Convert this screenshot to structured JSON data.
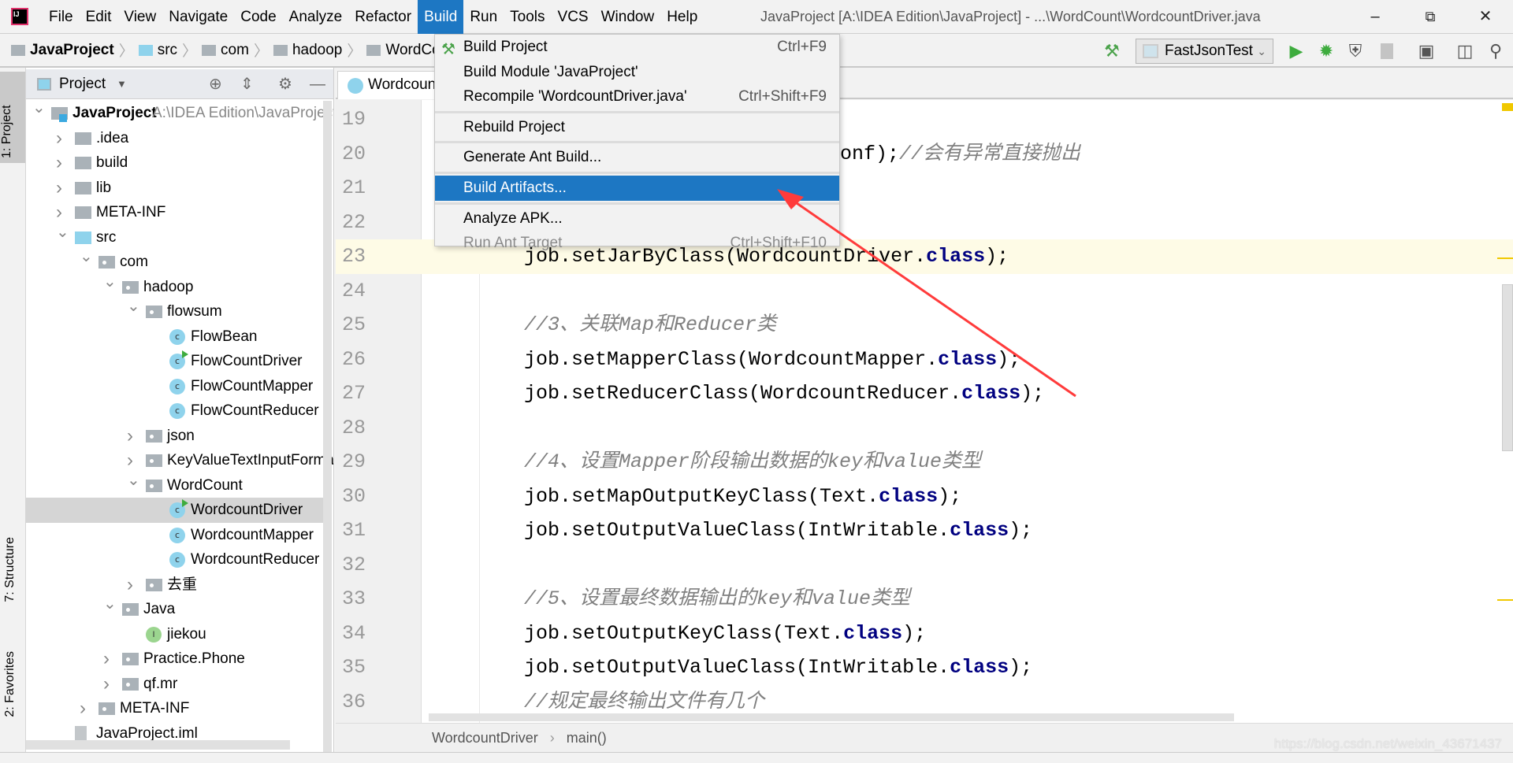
{
  "menubar": {
    "items": [
      "File",
      "Edit",
      "View",
      "Navigate",
      "Code",
      "Analyze",
      "Refactor",
      "Build",
      "Run",
      "Tools",
      "VCS",
      "Window",
      "Help"
    ],
    "active": "Build"
  },
  "window": {
    "title": "JavaProject [A:\\IDEA Edition\\JavaProject] - ...\\WordCount\\WordcountDriver.java"
  },
  "breadcrumb": [
    "JavaProject",
    "src",
    "com",
    "hadoop",
    "WordCount"
  ],
  "toolbar": {
    "run_config": "FastJsonTest"
  },
  "stripe": {
    "project": "1: Project",
    "structure": "7: Structure",
    "favorites": "2: Favorites"
  },
  "project_panel": {
    "title": "Project",
    "tree": [
      {
        "label": "JavaProject",
        "path": "A:\\IDEA Edition\\JavaProject",
        "level": 0,
        "state": "open",
        "icon": "module"
      },
      {
        "label": ".idea",
        "level": 1,
        "state": "closed",
        "icon": "folder"
      },
      {
        "label": "build",
        "level": 1,
        "state": "closed",
        "icon": "folder"
      },
      {
        "label": "lib",
        "level": 1,
        "state": "closed",
        "icon": "folder"
      },
      {
        "label": "META-INF",
        "level": 1,
        "state": "closed",
        "icon": "folder"
      },
      {
        "label": "src",
        "level": 1,
        "state": "open",
        "icon": "source-folder"
      },
      {
        "label": "com",
        "level": 2,
        "state": "open",
        "icon": "package"
      },
      {
        "label": "hadoop",
        "level": 3,
        "state": "open",
        "icon": "package"
      },
      {
        "label": "flowsum",
        "level": 4,
        "state": "open",
        "icon": "package"
      },
      {
        "label": "FlowBean",
        "level": 5,
        "icon": "class"
      },
      {
        "label": "FlowCountDriver",
        "level": 5,
        "icon": "class-runnable"
      },
      {
        "label": "FlowCountMapper",
        "level": 5,
        "icon": "class"
      },
      {
        "label": "FlowCountReducer",
        "level": 5,
        "icon": "class"
      },
      {
        "label": "json",
        "level": 4,
        "state": "closed",
        "icon": "package"
      },
      {
        "label": "KeyValueTextInputForma",
        "level": 4,
        "state": "closed",
        "icon": "package"
      },
      {
        "label": "WordCount",
        "level": 4,
        "state": "open",
        "icon": "package"
      },
      {
        "label": "WordcountDriver",
        "level": 5,
        "icon": "class-runnable",
        "selected": true
      },
      {
        "label": "WordcountMapper",
        "level": 5,
        "icon": "class"
      },
      {
        "label": "WordcountReducer",
        "level": 5,
        "icon": "class"
      },
      {
        "label": "去重",
        "level": 4,
        "state": "closed",
        "icon": "package"
      },
      {
        "label": "Java",
        "level": 3,
        "state": "open",
        "icon": "package"
      },
      {
        "label": "jiekou",
        "level": 4,
        "icon": "interface"
      },
      {
        "label": "Practice.Phone",
        "level": 3,
        "state": "closed",
        "icon": "package"
      },
      {
        "label": "qf.mr",
        "level": 3,
        "state": "closed",
        "icon": "package"
      },
      {
        "label": "META-INF",
        "level": 2,
        "state": "closed",
        "icon": "package"
      },
      {
        "label": "JavaProject.iml",
        "level": 1,
        "icon": "file"
      }
    ]
  },
  "editor": {
    "tab": "WordcountDriver.java",
    "caret_line": 23,
    "lines": [
      {
        "n": "19",
        "seg": []
      },
      {
        "n": "20",
        "seg": [
          {
            "t": "conf);"
          },
          {
            "t": "//会有异常直接抛出",
            "c": "cm"
          }
        ]
      },
      {
        "n": "21",
        "seg": []
      },
      {
        "n": "22",
        "seg": []
      },
      {
        "n": "23",
        "seg": [
          {
            "t": "job.setJarByClass(WordcountDriver."
          },
          {
            "t": "class",
            "c": "kw"
          },
          {
            "t": ");"
          }
        ]
      },
      {
        "n": "24",
        "seg": []
      },
      {
        "n": "25",
        "seg": [
          {
            "t": "//3、关联Map和Reducer类",
            "c": "cm"
          }
        ]
      },
      {
        "n": "26",
        "seg": [
          {
            "t": "job.setMapperClass(WordcountMapper."
          },
          {
            "t": "class",
            "c": "kw"
          },
          {
            "t": ");"
          }
        ]
      },
      {
        "n": "27",
        "seg": [
          {
            "t": "job.setReducerClass(WordcountReducer."
          },
          {
            "t": "class",
            "c": "kw"
          },
          {
            "t": ");"
          }
        ]
      },
      {
        "n": "28",
        "seg": []
      },
      {
        "n": "29",
        "seg": [
          {
            "t": "//4、设置Mapper阶段输出数据的key和value类型",
            "c": "cm"
          }
        ]
      },
      {
        "n": "30",
        "seg": [
          {
            "t": "job.setMapOutputKeyClass(Text."
          },
          {
            "t": "class",
            "c": "kw"
          },
          {
            "t": ");"
          }
        ]
      },
      {
        "n": "31",
        "seg": [
          {
            "t": "job.setOutputValueClass(IntWritable."
          },
          {
            "t": "class",
            "c": "kw"
          },
          {
            "t": ");"
          }
        ]
      },
      {
        "n": "32",
        "seg": []
      },
      {
        "n": "33",
        "seg": [
          {
            "t": "//5、设置最终数据输出的key和value类型",
            "c": "cm"
          }
        ]
      },
      {
        "n": "34",
        "seg": [
          {
            "t": "job.setOutputKeyClass(Text."
          },
          {
            "t": "class",
            "c": "kw"
          },
          {
            "t": ");"
          }
        ]
      },
      {
        "n": "35",
        "seg": [
          {
            "t": "job.setOutputValueClass(IntWritable."
          },
          {
            "t": "class",
            "c": "kw"
          },
          {
            "t": ");"
          }
        ]
      },
      {
        "n": "36",
        "seg": [
          {
            "t": "//规定最终输出文件有几个",
            "c": "cm"
          }
        ]
      }
    ],
    "breadcrumb": {
      "class": "WordcountDriver",
      "sep": "›",
      "method": "main()"
    }
  },
  "build_menu": {
    "items": [
      {
        "label": "Build Project",
        "shortcut": "Ctrl+F9",
        "icon": "hammer-icon"
      },
      {
        "label": "Build Module 'JavaProject'"
      },
      {
        "label": "Recompile 'WordcountDriver.java'",
        "shortcut": "Ctrl+Shift+F9"
      },
      {
        "sep": true
      },
      {
        "label": "Rebuild Project"
      },
      {
        "sep": true
      },
      {
        "label": "Generate Ant Build..."
      },
      {
        "sep": true
      },
      {
        "label": "Build Artifacts...",
        "highlighted": true
      },
      {
        "sep": true
      },
      {
        "label": "Analyze APK..."
      },
      {
        "label": "Run Ant Target",
        "shortcut": "Ctrl+Shift+F10",
        "disabled": true
      }
    ]
  },
  "annotation": {
    "color": "#ff3b3b",
    "points_to": "Build Artifacts..."
  },
  "watermark": "https://blog.csdn.net/weixin_43671437",
  "colors": {
    "accent": "#1d77c3",
    "keyword": "#000080",
    "comment": "#808080",
    "caret_row": "#fefbe6",
    "run_green": "#3eac3e"
  }
}
